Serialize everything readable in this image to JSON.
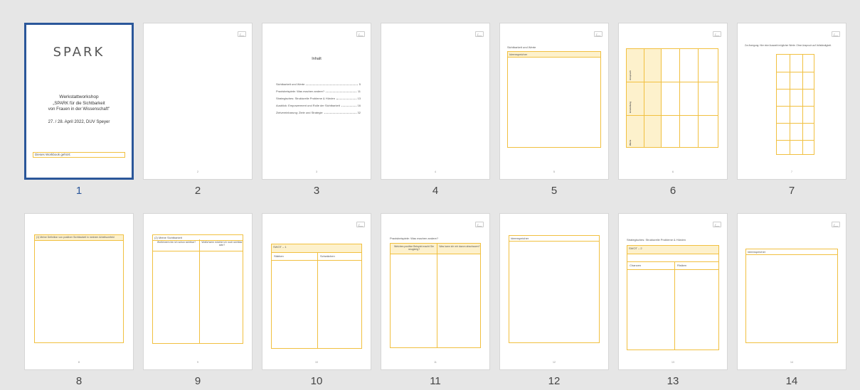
{
  "cover": {
    "logo_text": "SPARK",
    "title": "Werkstattworkshop",
    "subtitle_1": "„SPARK für die Sichtbarkeit",
    "subtitle_2": "von Frauen in der Wissenschaft\"",
    "date": "27. / 28. April 2022, DUV Speyer",
    "owner_field": "Dieses Workbook gehört:"
  },
  "toc": {
    "heading": "Inhalt",
    "entries": [
      {
        "text": "Sichtbarkeit und Werte",
        "page": "5"
      },
      {
        "text": "Praxisbeispiele: Was machen andere?",
        "page": "11"
      },
      {
        "text": "Strategisches: Strukturelle Probleme & Hürden",
        "page": "13"
      },
      {
        "text": "Ausblick: Empowerment und Rolle der Sichtbarkeit",
        "page": "16"
      },
      {
        "text": "Zielvereinbarung: Ziele und Strategie",
        "page": "32"
      }
    ]
  },
  "page5": {
    "heading": "Sichtbarkeit und Werte",
    "box_header": "Ideenspeicher"
  },
  "page6": {
    "rows": [
      "Anspruch",
      "Einstellung",
      "Werte"
    ]
  },
  "page7": {
    "heading": "Zur Anregung: Hier eine Auswahl möglicher Werte. Ohne Anspruch auf Vollständigkeit."
  },
  "page8": {
    "box_header": "(1) Meine Definition von positiver Sichtbarkeit in meinem Arbeitsumfeld"
  },
  "page9": {
    "box_header": "(2) Meine Sichtbarkeit",
    "col1": "Wofür/wem bin ich schon sichtbar?",
    "col2": "Wofür/wem möchte ich noch sichtbar sein?"
  },
  "page10": {
    "box_header": "SWOT – 1",
    "col1": "Stärken",
    "col2": "Schwächen"
  },
  "page11": {
    "heading": "Praxisbeispiele: Was machen andere?",
    "col1": "Welches positive Beispiel macht Sie neugierig?",
    "col2": "Was kann ich mir davon abschauen?"
  },
  "page12": {
    "box_header": "Ideenspeicher"
  },
  "page13": {
    "heading": "Strategisches: Strukturelle Probleme & Hürden",
    "box_header": "SWOT – 2",
    "col1": "Chancen",
    "col2": "Risiken"
  },
  "page14": {
    "box_header": "Ideenspeicher"
  },
  "pages": [
    {
      "label": "1",
      "num": ""
    },
    {
      "label": "2",
      "num": "2"
    },
    {
      "label": "3",
      "num": "3"
    },
    {
      "label": "4",
      "num": "4"
    },
    {
      "label": "5",
      "num": "5"
    },
    {
      "label": "6",
      "num": "6"
    },
    {
      "label": "7",
      "num": "7"
    },
    {
      "label": "8",
      "num": "8"
    },
    {
      "label": "9",
      "num": "9"
    },
    {
      "label": "10",
      "num": "10"
    },
    {
      "label": "11",
      "num": "11"
    },
    {
      "label": "12",
      "num": "12"
    },
    {
      "label": "13",
      "num": "13"
    },
    {
      "label": "14",
      "num": "14"
    }
  ],
  "colors": {
    "selected_border": "#2b579a",
    "accent_yellow": "#f1c040",
    "background": "#e6e6e6"
  }
}
